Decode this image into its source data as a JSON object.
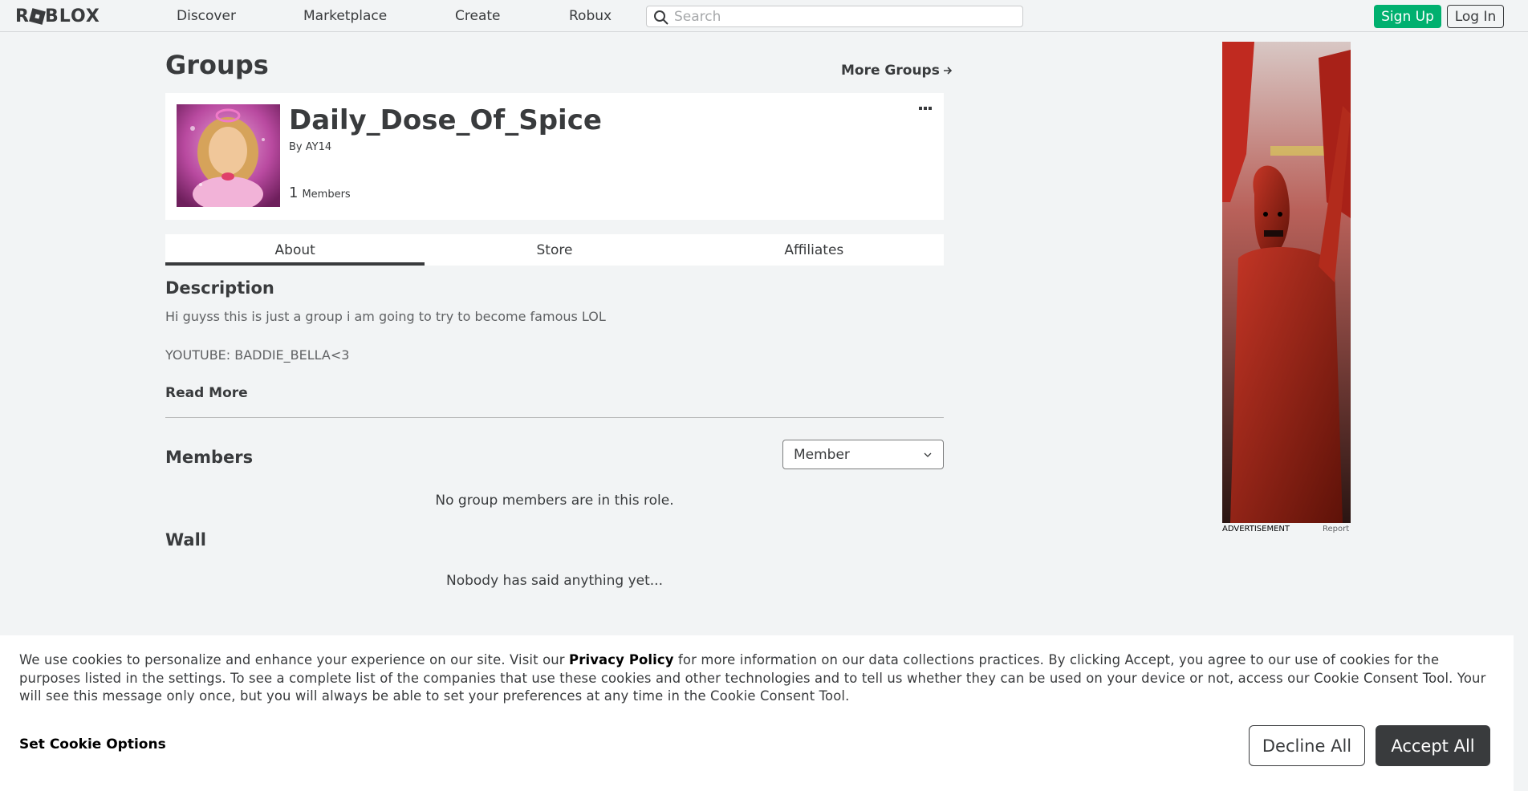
{
  "header": {
    "logo_text": "ROBLOX",
    "nav": [
      "Discover",
      "Marketplace",
      "Create",
      "Robux"
    ],
    "search_placeholder": "Search",
    "signup_label": "Sign Up",
    "login_label": "Log In"
  },
  "page": {
    "title": "Groups",
    "more_groups": "More Groups"
  },
  "group": {
    "name": "Daily_Dose_Of_Spice",
    "by_prefix": "By",
    "owner": "AY14",
    "member_count": "1",
    "member_label": "Members"
  },
  "tabs": [
    "About",
    "Store",
    "Affiliates"
  ],
  "about": {
    "description_heading": "Description",
    "description_lines": [
      "Hi guyss this is just a group i am going to try to become famous LOL",
      "YOUTUBE: BADDIE_BELLA<3"
    ],
    "read_more": "Read More",
    "members_heading": "Members",
    "role_selected": "Member",
    "no_members": "No group members are in this role.",
    "wall_heading": "Wall",
    "wall_empty": "Nobody has said anything yet..."
  },
  "ad": {
    "label": "ADVERTISEMENT",
    "report": "Report"
  },
  "cookie": {
    "text_before": "We use cookies to personalize and enhance your experience on our site. Visit our ",
    "privacy_link": "Privacy Policy",
    "text_after": " for more information on our data collections practices. By clicking Accept, you agree to our use of cookies for the purposes listed in the settings. To see a complete list of the companies that use these cookies and other technologies and to tell us whether they can be used on your device or not, access our Cookie Consent Tool. Your will see this message only once, but you will always be able to set your preferences at any time in the Cookie Consent Tool.",
    "set_options": "Set Cookie Options",
    "decline": "Decline All",
    "accept": "Accept All"
  },
  "colors": {
    "signup_green": "#00b06f",
    "text_dark": "#393b3d",
    "background": "#f2f4f5"
  }
}
